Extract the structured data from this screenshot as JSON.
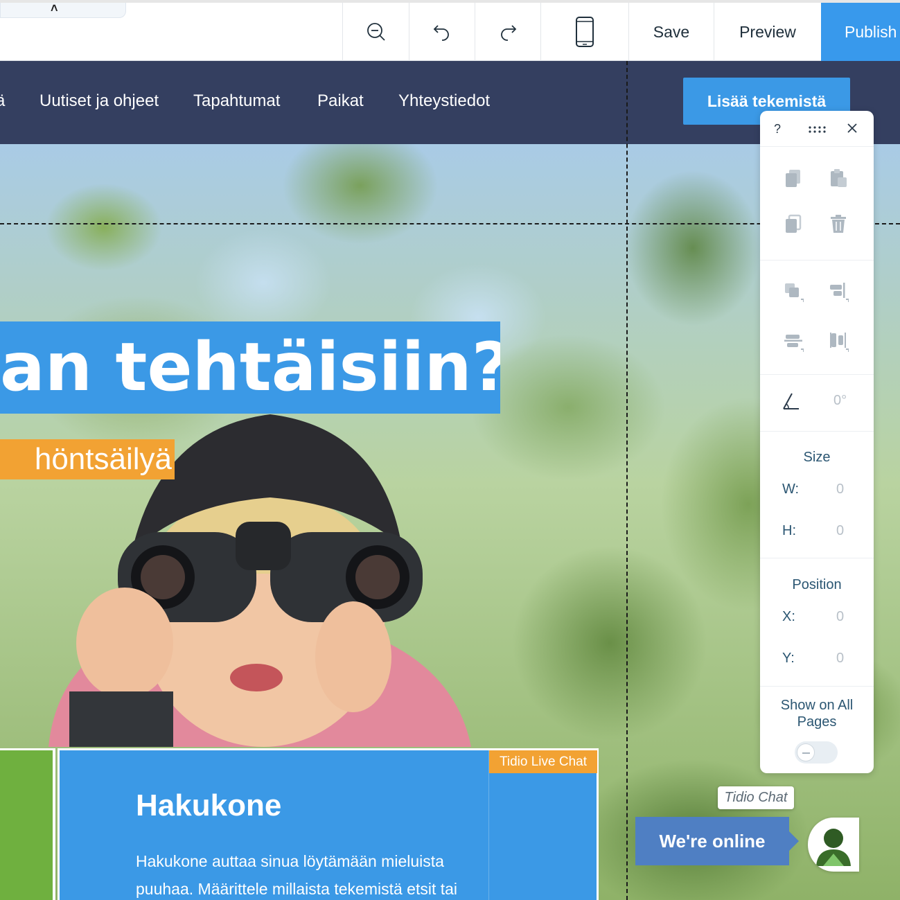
{
  "toolbar": {
    "collapse_caret": "˄",
    "zoom_out_icon": "zoom-out-icon",
    "undo_icon": "undo-icon",
    "redo_icon": "redo-icon",
    "mobile_icon": "mobile-view-icon",
    "save_label": "Save",
    "preview_label": "Preview",
    "publish_label": "Publish"
  },
  "site_nav": {
    "items": [
      {
        "label": "ä"
      },
      {
        "label": "Uutiset ja ohjeet"
      },
      {
        "label": "Tapahtumat"
      },
      {
        "label": "Paikat"
      },
      {
        "label": "Yhteystiedot"
      }
    ],
    "cta_label": "Lisää tekemistä"
  },
  "hero": {
    "headline": "an tehtäisiin?",
    "subheadline": "höntsäilyä"
  },
  "cards": {
    "search_title": "Hakukone",
    "search_body": "Hakukone auttaa sinua löytämään mieluista puuhaa. Määrittele millaista tekemistä etsit tai",
    "chat_widget_label": "Tidio Live Chat"
  },
  "tools_panel": {
    "help_label": "?",
    "angle_value": "0°",
    "size_title": "Size",
    "width_label": "W:",
    "width_value": "0",
    "height_label": "H:",
    "height_value": "0",
    "position_title": "Position",
    "x_label": "X:",
    "x_value": "0",
    "y_label": "Y:",
    "y_value": "0",
    "show_on_all_pages_label": "Show on All Pages",
    "show_on_all_pages_on": false
  },
  "tidio": {
    "tag_label": "Tidio Chat",
    "online_label": "We're online"
  },
  "colors": {
    "publish_blue": "#3899ec",
    "nav_navy": "#343f60",
    "accent_orange": "#f2a233",
    "card_green": "#6fb03f",
    "chat_blue": "#4f7fc3"
  }
}
